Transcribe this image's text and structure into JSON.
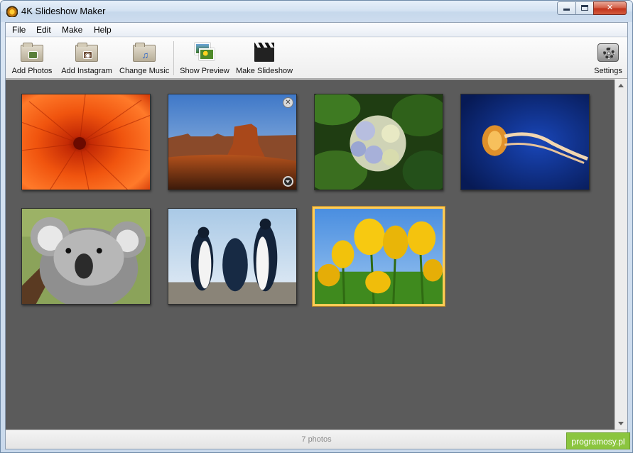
{
  "window": {
    "title": "4K Slideshow Maker"
  },
  "menu": {
    "items": [
      "File",
      "Edit",
      "Make",
      "Help"
    ]
  },
  "toolbar": {
    "add_photos": "Add Photos",
    "add_instagram": "Add Instagram",
    "change_music": "Change Music",
    "show_preview": "Show Preview",
    "make_slideshow": "Make Slideshow",
    "settings": "Settings"
  },
  "photos": [
    {
      "subject": "chrysanthemum",
      "selected": false
    },
    {
      "subject": "desert",
      "selected": false,
      "hover_controls": true
    },
    {
      "subject": "hydrangeas",
      "selected": false
    },
    {
      "subject": "jellyfish",
      "selected": false
    },
    {
      "subject": "koala",
      "selected": false
    },
    {
      "subject": "penguins",
      "selected": false
    },
    {
      "subject": "tulips",
      "selected": true
    }
  ],
  "status": {
    "text": "7 photos"
  },
  "watermark": {
    "text": "programosy.pl"
  },
  "colors": {
    "canvas": "#5b5b5b",
    "selection": "#ffcc55",
    "watermark": "#8bc53f"
  }
}
